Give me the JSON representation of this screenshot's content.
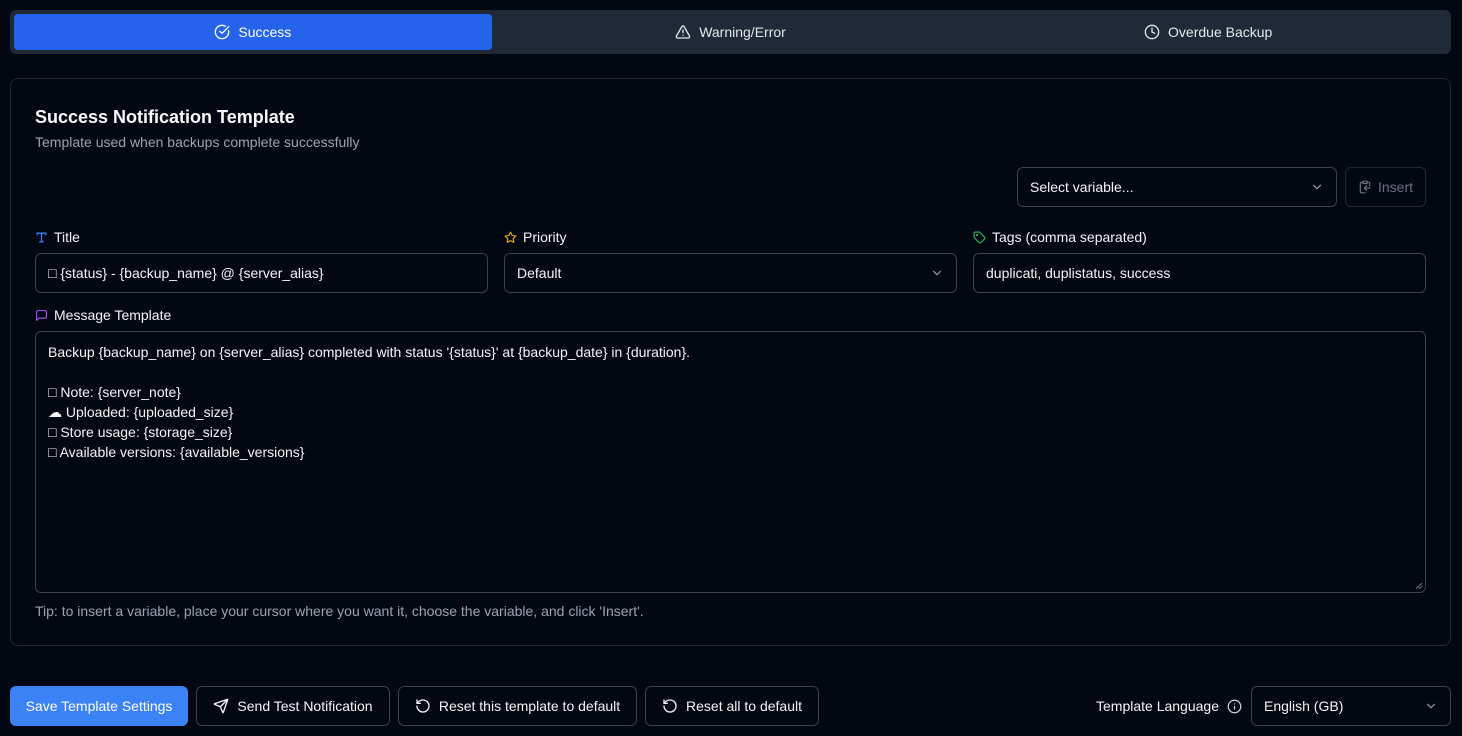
{
  "tabs": [
    {
      "label": "Success",
      "icon": "check-circle-icon",
      "active": true
    },
    {
      "label": "Warning/Error",
      "icon": "warning-triangle-icon",
      "active": false
    },
    {
      "label": "Overdue Backup",
      "icon": "clock-icon",
      "active": false
    }
  ],
  "card": {
    "title": "Success Notification Template",
    "subtitle": "Template used when backups complete successfully"
  },
  "variable_picker": {
    "placeholder": "Select variable...",
    "insert_label": "Insert"
  },
  "fields": {
    "title_label": "Title",
    "title_value": "□ {status} - {backup_name} @ {server_alias}",
    "priority_label": "Priority",
    "priority_value": "Default",
    "tags_label": "Tags (comma separated)",
    "tags_value": "duplicati, duplistatus, success",
    "message_label": "Message Template",
    "message_value": "Backup {backup_name} on {server_alias} completed with status '{status}' at {backup_date} in {duration}.\n\n□ Note: {server_note}\n☁ Uploaded: {uploaded_size}\n□ Store usage: {storage_size}\n□ Available versions: {available_versions}"
  },
  "tip": "Tip: to insert a variable, place your cursor where you want it, choose the variable, and click 'Insert'.",
  "footer": {
    "save_label": "Save Template Settings",
    "test_label": "Send Test Notification",
    "reset_one_label": "Reset this template to default",
    "reset_all_label": "Reset all to default",
    "language_label": "Template Language",
    "language_value": "English (GB)"
  },
  "colors": {
    "accent": "#2563eb",
    "primary_button": "#3b82f6",
    "title_icon": "#3b82f6",
    "priority_icon": "#eab308",
    "tags_icon": "#22c55e",
    "message_icon": "#a855f7"
  }
}
